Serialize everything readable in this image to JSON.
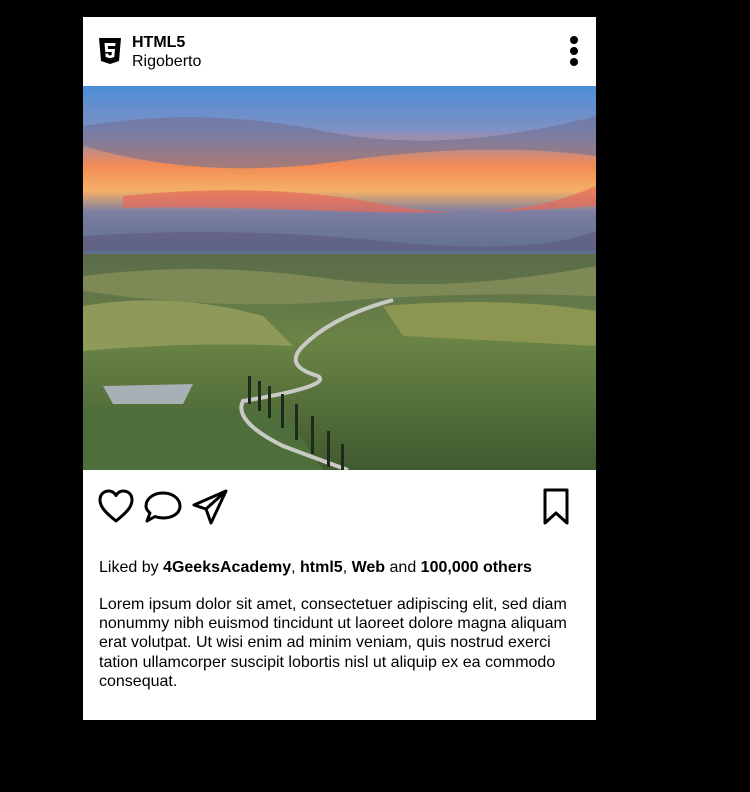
{
  "post": {
    "account_name": "HTML5",
    "author": "Rigoberto",
    "logo_icon": "html5-icon",
    "more_icon": "vertical-dots-icon",
    "image_alt": "Winding cypress-lined road through rolling green hills at sunset",
    "actions": {
      "like_icon": "heart-icon",
      "comment_icon": "comment-icon",
      "share_icon": "paper-plane-icon",
      "save_icon": "bookmark-icon"
    },
    "likes": {
      "prefix": "Liked by ",
      "users": [
        "4GeeksAcademy",
        "html5",
        "Web"
      ],
      "sep": ", ",
      "and": " and ",
      "others": "100,000 others"
    },
    "caption": "Lorem ipsum dolor sit amet, consectetuer adipiscing elit, sed diam nonummy nibh euismod tincidunt ut laoreet dolore magna aliquam erat volutpat. Ut wisi enim ad minim veniam, quis nostrud exerci tation ullamcorper suscipit lobortis nisl ut aliquip ex ea commodo consequat."
  },
  "colors": {
    "background": "#000000",
    "card": "#ffffff",
    "text": "#000000"
  }
}
